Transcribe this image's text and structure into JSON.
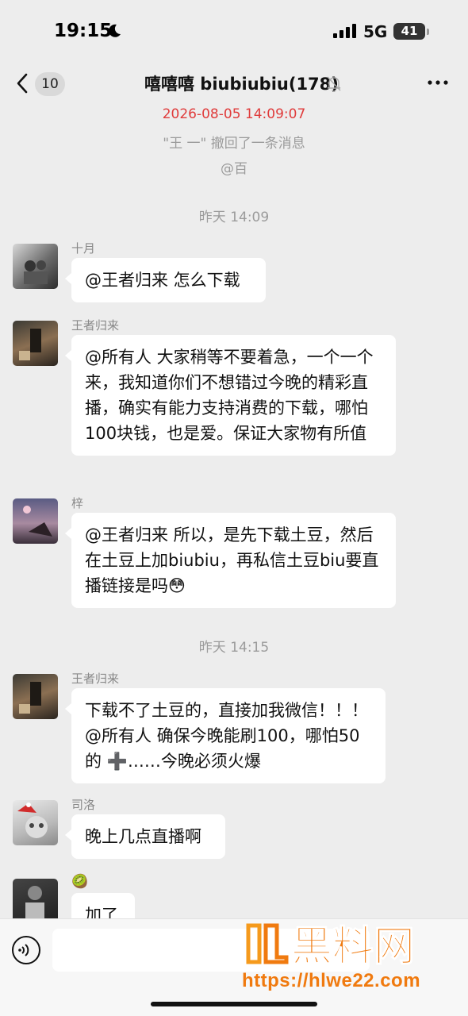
{
  "status_bar": {
    "time": "19:15",
    "network": "5G",
    "battery": "41"
  },
  "header": {
    "back_count": "10",
    "title": "嘻嘻嘻 biubiubiu(178)"
  },
  "system_messages": {
    "timestamp_top": "2026-08-05 14:09:07",
    "recall_notice": "\"王 一\" 撤回了一条消息",
    "mention": "@百",
    "time_1": "昨天 14:09",
    "time_2": "昨天 14:15"
  },
  "messages": [
    {
      "sender": "十月",
      "text": "@王者归来 怎么下载"
    },
    {
      "sender": "王者归来",
      "text": "@所有人 大家稍等不要着急，一个一个来，我知道你们不想错过今晚的精彩直播，确实有能力支持消费的下载，哪怕100块钱，也是爱。保证大家物有所值"
    },
    {
      "sender": "梓",
      "text": "@王者归来 所以，是先下载土豆，然后在土豆上加biubiu，再私信土豆biu要直播链接是吗😳"
    },
    {
      "sender": "王者归来",
      "text": "下载不了土豆的，直接加我微信！！！@所有人 确保今晚能刷100，哪怕50的 ➕……今晚必须火爆"
    },
    {
      "sender": "司洛",
      "text": "晚上几点直播啊"
    },
    {
      "sender": "🥝",
      "text": "加了"
    }
  ],
  "watermark": {
    "brand": "黑料网",
    "url": "https://hlwe22.com"
  },
  "icons": {
    "moon": "moon-icon",
    "signal": "signal-icon",
    "mute": "bell-off-icon",
    "more": "more-icon",
    "voice": "voice-icon",
    "back": "chevron-left-icon"
  }
}
